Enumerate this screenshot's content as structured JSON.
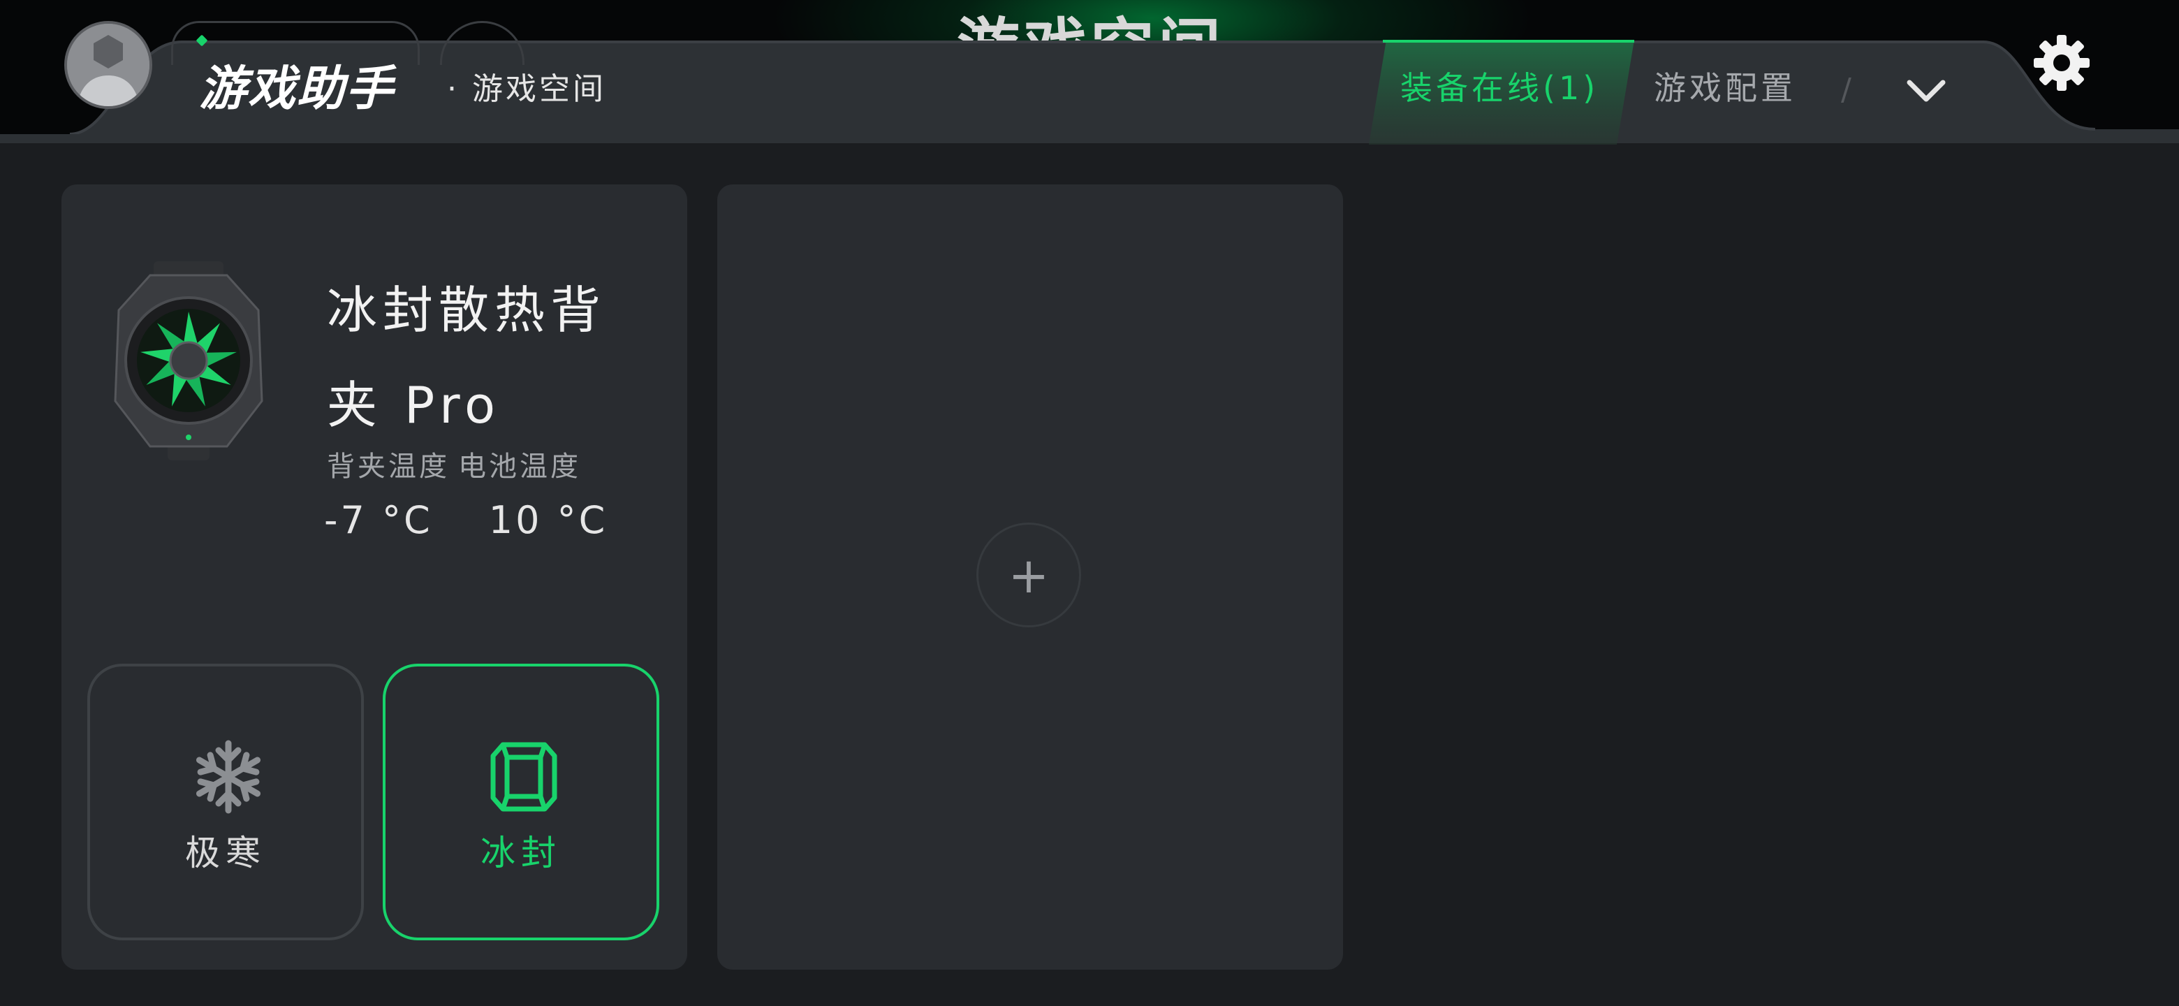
{
  "header": {
    "background_title": "游戏空间",
    "brand": "游戏助手",
    "brand_sub": "· 游戏空间",
    "tabs": [
      {
        "label": "装备在线(1)",
        "active": true
      },
      {
        "label": "游戏配置",
        "active": false
      }
    ],
    "separator": "/",
    "icons": [
      "avatar-icon",
      "chevron-down-icon",
      "gear-icon"
    ]
  },
  "device": {
    "name_line1": "冰封散热背",
    "name_line2": "夹 Pro",
    "temp_labels": [
      "背夹温度",
      "电池温度"
    ],
    "temp_values": [
      "-7 °C",
      "10 °C"
    ],
    "modes": [
      {
        "label": "极寒",
        "icon": "snowflake-icon",
        "selected": false
      },
      {
        "label": "冰封",
        "icon": "ice-block-icon",
        "selected": true
      }
    ]
  },
  "add_device": {
    "symbol": "+"
  },
  "colors": {
    "accent": "#18d36b",
    "background": "#1b1d20",
    "card": "#292c30",
    "header": "#2d3135"
  }
}
